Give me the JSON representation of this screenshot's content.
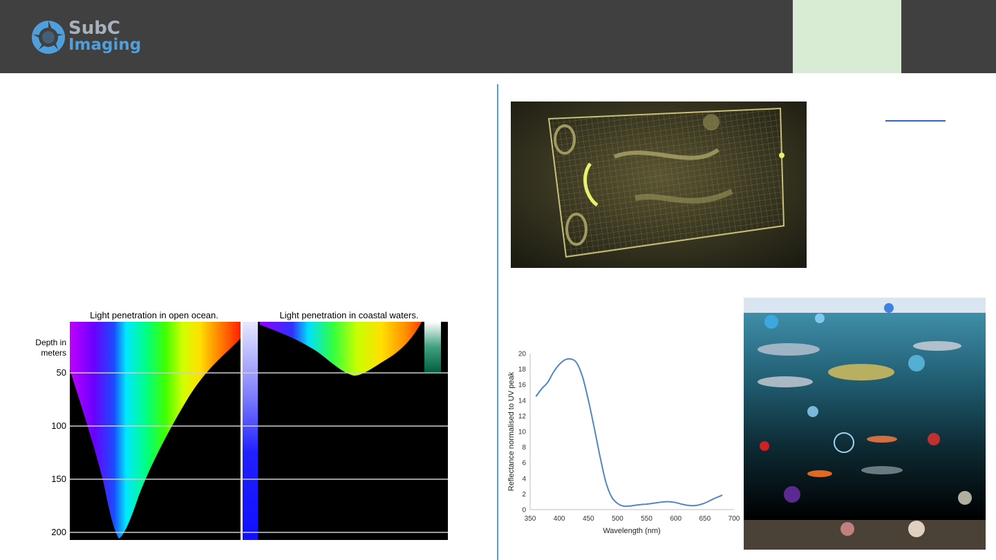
{
  "header": {
    "logo_line1": "SubC",
    "logo_line2": "Imaging",
    "colors": {
      "bar": "#404040",
      "accent_block": "#d8ecd4",
      "logo_blue": "#4f9fdc",
      "logo_grey": "#a9b2bc"
    }
  },
  "penetration_figure": {
    "title_open": "Light penetration in open ocean.",
    "title_coastal": "Light penetration in coastal waters.",
    "depth_label_line1": "Depth in",
    "depth_label_line2": "meters",
    "depth_ticks": [
      "50",
      "100",
      "150",
      "200"
    ],
    "open_ocean_max_depth_m": 205,
    "coastal_max_depth_m": 52
  },
  "chart_data": {
    "type": "line",
    "title": "",
    "xlabel": "Wavelength (nm)",
    "ylabel": "Reflectance normalised to UV peak",
    "xlim": [
      350,
      700
    ],
    "ylim": [
      0,
      20
    ],
    "x_ticks": [
      "350",
      "400",
      "450",
      "500",
      "550",
      "600",
      "650",
      "700"
    ],
    "y_ticks": [
      "0",
      "2",
      "4",
      "6",
      "8",
      "10",
      "12",
      "14",
      "16",
      "18",
      "20"
    ],
    "grid": false,
    "series": [
      {
        "color": "#4f86c6",
        "x": [
          360,
          370,
          380,
          390,
          400,
          410,
          420,
          430,
          440,
          450,
          460,
          470,
          480,
          490,
          500,
          510,
          520,
          530,
          540,
          550,
          560,
          570,
          580,
          590,
          600,
          610,
          620,
          630,
          640,
          650,
          660,
          670,
          680
        ],
        "y": [
          14.5,
          15.5,
          16.3,
          17.6,
          18.6,
          19.2,
          19.3,
          18.8,
          17.0,
          14.0,
          10.5,
          6.8,
          3.5,
          1.6,
          0.8,
          0.45,
          0.45,
          0.55,
          0.65,
          0.7,
          0.8,
          0.9,
          1.0,
          1.0,
          0.9,
          0.7,
          0.55,
          0.5,
          0.6,
          0.85,
          1.2,
          1.55,
          1.85
        ]
      }
    ]
  }
}
